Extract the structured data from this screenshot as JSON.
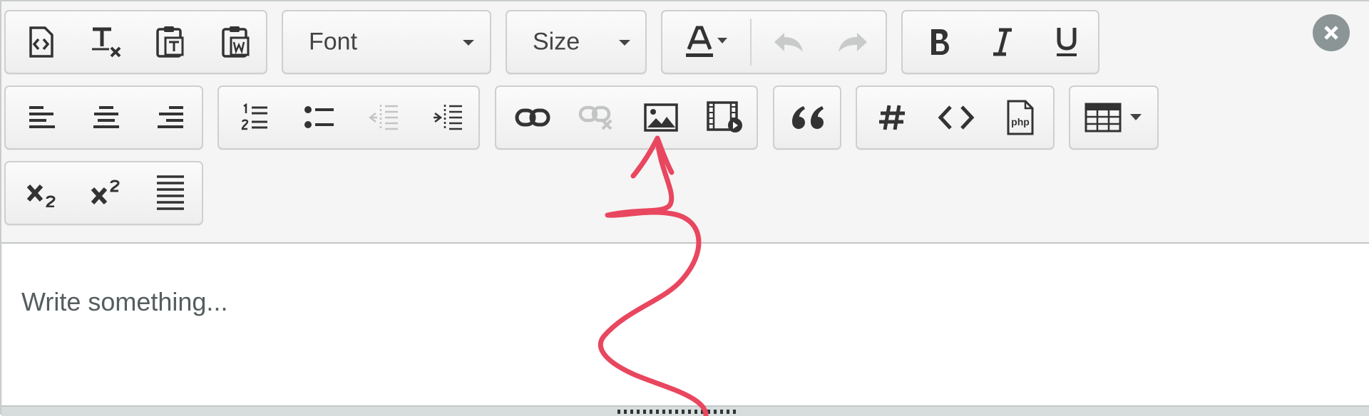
{
  "toolbar": {
    "font_label": "Font",
    "size_label": "Size",
    "close_icon": "close-circle-icon",
    "groups": {
      "clipboard": [
        "source-code-icon",
        "remove-format-icon",
        "paste-text-icon",
        "paste-word-icon"
      ],
      "text_color": [
        "font-color-icon",
        "undo-icon",
        "redo-icon"
      ],
      "basic_styles": [
        "bold-icon",
        "italic-icon",
        "underline-icon"
      ],
      "align": [
        "align-left-icon",
        "align-center-icon",
        "align-right-icon"
      ],
      "lists": [
        "ordered-list-icon",
        "unordered-list-icon",
        "outdent-icon",
        "indent-icon"
      ],
      "links": [
        "link-icon",
        "unlink-icon",
        "image-icon",
        "video-icon"
      ],
      "quote": [
        "blockquote-icon"
      ],
      "code": [
        "hashtag-icon",
        "code-icon",
        "php-icon"
      ],
      "table": [
        "table-icon"
      ],
      "scripts": [
        "subscript-icon",
        "superscript-icon",
        "justify-icon"
      ]
    },
    "disabled": [
      "undo-icon",
      "redo-icon",
      "unlink-icon",
      "outdent-icon"
    ]
  },
  "editor": {
    "placeholder": "Write something..."
  },
  "annotation": {
    "arrow_color": "#e8475f",
    "points_to": "image-icon"
  }
}
